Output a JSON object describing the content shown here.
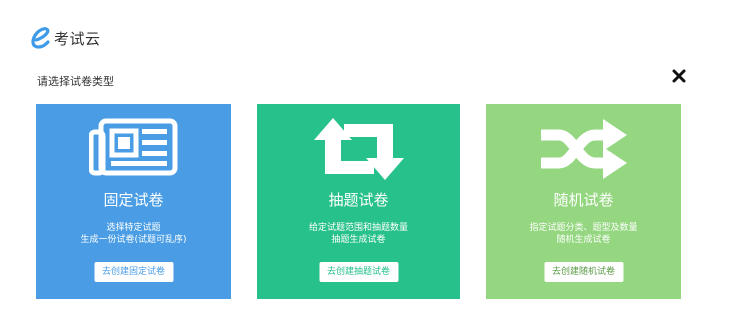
{
  "header": {
    "logo_text": "考试云"
  },
  "dialog": {
    "prompt": "请选择试卷类型",
    "close_icon": "close-icon"
  },
  "cards": [
    {
      "icon": "newspaper-icon",
      "title": "固定试卷",
      "desc_line1": "选择特定试题",
      "desc_line2": "生成一份试卷(试题可乱序)",
      "button_label": "去创建固定试卷",
      "color": "#4a9de5"
    },
    {
      "icon": "retweet-icon",
      "title": "抽题试卷",
      "desc_line1": "给定试题范围和抽题数量",
      "desc_line2": "抽题生成试卷",
      "button_label": "去创建抽题试卷",
      "color": "#27c18b"
    },
    {
      "icon": "shuffle-icon",
      "title": "随机试卷",
      "desc_line1": "指定试题分类、题型及数量",
      "desc_line2": "随机生成试卷",
      "button_label": "去创建随机试卷",
      "color": "#94d780"
    }
  ]
}
